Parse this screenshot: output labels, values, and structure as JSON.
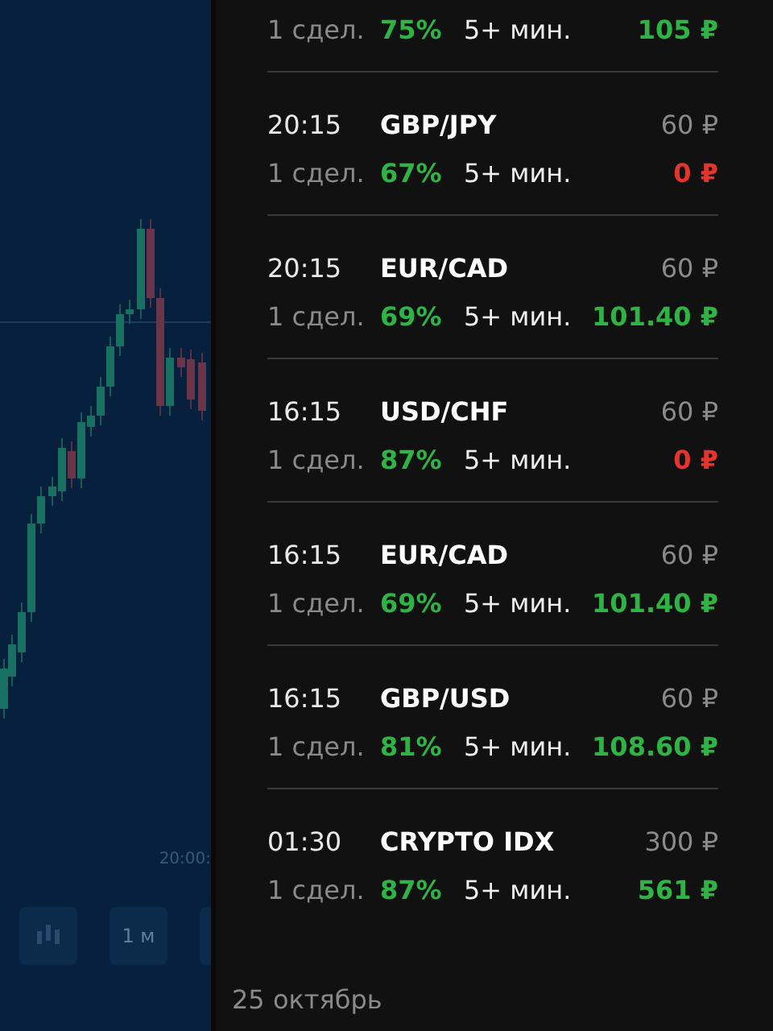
{
  "chart": {
    "time_label": "20:00:",
    "buttons": [
      {
        "kind": "icon"
      },
      {
        "kind": "text",
        "label": "1 м"
      },
      {
        "kind": "blank"
      }
    ]
  },
  "trades": [
    {
      "deals": "1 сдел.",
      "percent": "75%",
      "duration": "5+ мин.",
      "payout": "105 ₽",
      "loss": false
    },
    {
      "time": "20:15",
      "pair": "GBP/JPY",
      "stake": "60 ₽",
      "deals": "1 сдел.",
      "percent": "67%",
      "duration": "5+ мин.",
      "payout": "0 ₽",
      "loss": true
    },
    {
      "time": "20:15",
      "pair": "EUR/CAD",
      "stake": "60 ₽",
      "deals": "1 сдел.",
      "percent": "69%",
      "duration": "5+ мин.",
      "payout": "101.40 ₽",
      "loss": false
    },
    {
      "time": "16:15",
      "pair": "USD/CHF",
      "stake": "60 ₽",
      "deals": "1 сдел.",
      "percent": "87%",
      "duration": "5+ мин.",
      "payout": "0 ₽",
      "loss": true
    },
    {
      "time": "16:15",
      "pair": "EUR/CAD",
      "stake": "60 ₽",
      "deals": "1 сдел.",
      "percent": "69%",
      "duration": "5+ мин.",
      "payout": "101.40 ₽",
      "loss": false
    },
    {
      "time": "16:15",
      "pair": "GBP/USD",
      "stake": "60 ₽",
      "deals": "1 сдел.",
      "percent": "81%",
      "duration": "5+ мин.",
      "payout": "108.60 ₽",
      "loss": false
    },
    {
      "time": "01:30",
      "pair": "CRYPTO IDX",
      "stake": "300 ₽",
      "deals": "1 сдел.",
      "percent": "87%",
      "duration": "5+ мин.",
      "payout": "561 ₽",
      "loss": false
    }
  ],
  "date_header": "25 октябрь"
}
